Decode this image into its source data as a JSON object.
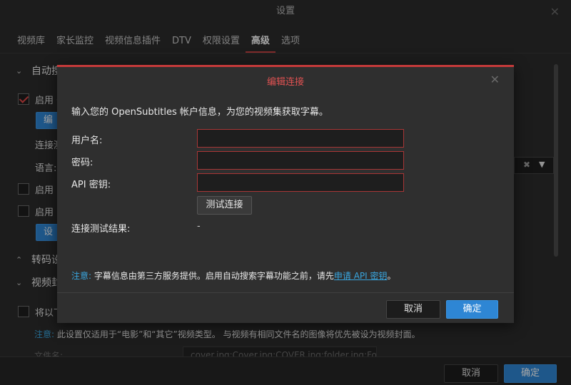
{
  "window": {
    "title": "设置",
    "close_glyph": "✕"
  },
  "tabs": [
    {
      "label": "视频库",
      "active": false
    },
    {
      "label": "家长监控",
      "active": false
    },
    {
      "label": "视频信息插件",
      "active": false
    },
    {
      "label": "DTV",
      "active": false
    },
    {
      "label": "权限设置",
      "active": false
    },
    {
      "label": "高级",
      "active": true
    },
    {
      "label": "选项",
      "active": false
    }
  ],
  "background": {
    "sections": {
      "auto_subtitle": "自动搜",
      "transcode": "转码设",
      "video_cover": "视频封"
    },
    "enable_1": "启用 O",
    "edit_btn": "编辑",
    "conn_label": "连接测",
    "lang_label": "语言:",
    "enable_2": "启用 S",
    "enable_3": "启用 S",
    "settings_btn": "设置",
    "cover_option": "将以下",
    "note_prefix": "注意:",
    "note_text": "此设置仅适用于“电影”和“其它”视频类型。 与视频有相同文件名的图像将优先被设为视频封面。",
    "filename_label": "文件名:",
    "filename_value": "cover.jpg;Cover.jpg;COVER.jpg;folder.jpg;Fol",
    "dropdown_clear": "✖",
    "dropdown_arrow": "▼",
    "cancel": "取消",
    "ok": "确定"
  },
  "modal": {
    "title": "编辑连接",
    "close_glyph": "✕",
    "description": "输入您的 OpenSubtitles 帐户信息，为您的视频集获取字幕。",
    "username_label": "用户名:",
    "username_value": "",
    "password_label": "密码:",
    "password_value": "",
    "api_key_label": "API 密钥:",
    "api_key_value": "",
    "test_button": "测试连接",
    "result_label": "连接测试结果:",
    "result_value": "-",
    "note_prefix": "注意:",
    "note_text": " 字幕信息由第三方服务提供。启用自动搜索字幕功能之前，请先",
    "note_link": "申请 API 密钥",
    "note_suffix": "。",
    "cancel": "取消",
    "ok": "确定"
  },
  "colors": {
    "accent_red": "#c43a3a",
    "accent_blue": "#2e86d4",
    "link_blue": "#39a6df"
  }
}
